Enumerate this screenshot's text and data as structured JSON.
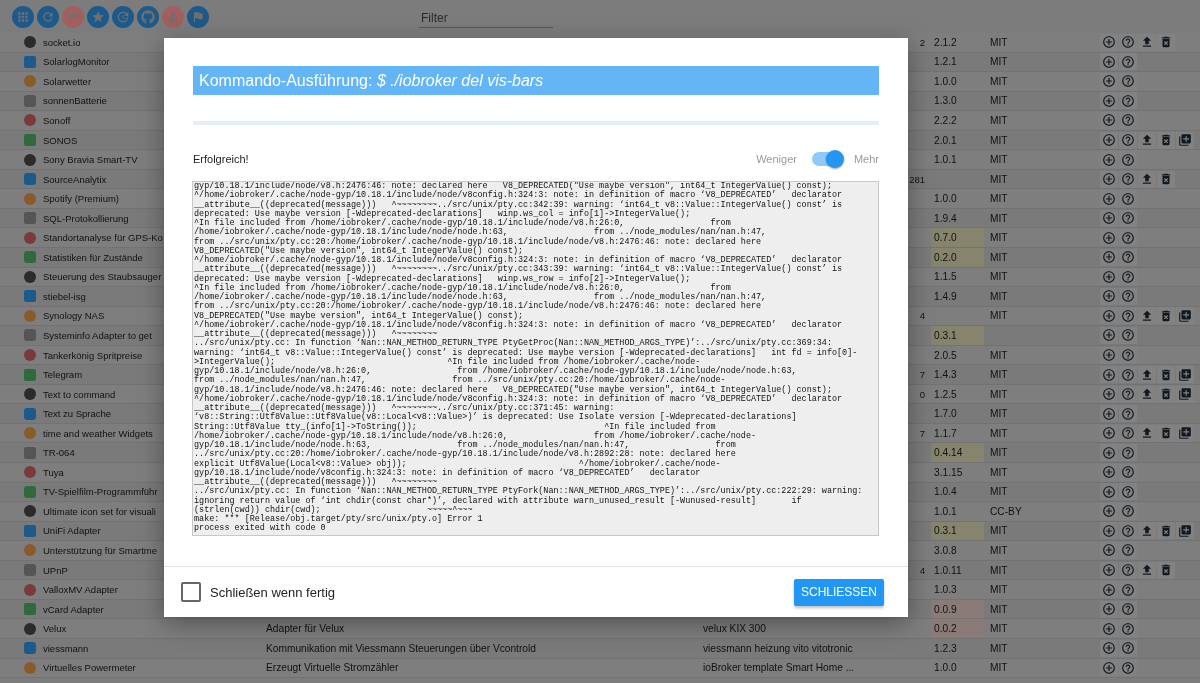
{
  "toolbar": {
    "buttons": [
      {
        "kind": "apps",
        "color": "#1d5a8c"
      },
      {
        "kind": "refresh",
        "color": "#1d5a8c"
      },
      {
        "kind": "list",
        "color": "#a35f5f"
      },
      {
        "kind": "star",
        "color": "#1d5a8c"
      },
      {
        "kind": "update",
        "color": "#1d5a8c"
      },
      {
        "kind": "github",
        "color": "#1d5a8c"
      },
      {
        "kind": "person",
        "color": "#a35f5f"
      },
      {
        "kind": "flag",
        "color": "#1d5a8c"
      }
    ],
    "filter": {
      "placeholder": "Filter"
    }
  },
  "adapters": [
    {
      "name": "socket.io",
      "installed": "2",
      "version": "2.1.2",
      "license": "MIT",
      "upgrade": true,
      "delete": true,
      "add_instance": false
    },
    {
      "name": "SolarlogMonitor",
      "version": "1.2.1",
      "license": "MIT",
      "upgrade": false,
      "delete": false,
      "add_instance": false
    },
    {
      "name": "Solarwetter",
      "version": "1.0.0",
      "license": "MIT",
      "upgrade": false,
      "delete": false,
      "add_instance": false
    },
    {
      "name": "sonnenBatterie",
      "version": "1.3.0",
      "license": "MIT",
      "upgrade": false,
      "delete": false,
      "add_instance": false
    },
    {
      "name": "Sonoff",
      "version": "2.2.2",
      "license": "MIT",
      "upgrade": false,
      "delete": false,
      "add_instance": false
    },
    {
      "name": "SONOS",
      "version": "2.0.1",
      "license": "MIT",
      "upgrade": true,
      "delete": true,
      "add_instance": true
    },
    {
      "name": "Sony Bravia Smart-TV",
      "version": "1.0.1",
      "license": "MIT",
      "upgrade": false,
      "delete": false,
      "add_instance": false
    },
    {
      "name": "SourceAnalytix",
      "installed": "281",
      "license": "MIT",
      "upgrade": true,
      "delete": true,
      "add_instance": false
    },
    {
      "name": "Spotify (Premium)",
      "version": "1.0.0",
      "license": "MIT",
      "upgrade": false,
      "delete": false,
      "add_instance": false
    },
    {
      "name": "SQL-Protokollierung",
      "version": "1.9.4",
      "license": "MIT",
      "upgrade": false,
      "delete": false,
      "add_instance": false
    },
    {
      "name": "Standortanalyse für GPS-Ko",
      "version": "0.7.0",
      "color": "#86846c",
      "license": "MIT",
      "upgrade": false,
      "delete": false,
      "add_instance": false
    },
    {
      "name": "Statistiken für Zustände",
      "version": "0.2.0",
      "color": "#86846c",
      "license": "MIT",
      "upgrade": false,
      "delete": false,
      "add_instance": false
    },
    {
      "name": "Steuerung des Staubsauger",
      "version": "1.1.5",
      "license": "MIT",
      "upgrade": false,
      "delete": false,
      "add_instance": false
    },
    {
      "name": "stiebel-isg",
      "version": "1.4.9",
      "license": "MIT",
      "upgrade": false,
      "delete": false,
      "add_instance": false
    },
    {
      "name": "Synology NAS",
      "installed": "4",
      "license": "MIT",
      "upgrade": true,
      "delete": true,
      "add_instance": true
    },
    {
      "name": "Systeminfo Adapter to get",
      "version": "0.3.1",
      "color": "#86846c",
      "upgrade": false,
      "delete": false,
      "add_instance": false
    },
    {
      "name": "Tankerkönig Spritpreise",
      "version": "2.0.5",
      "license": "MIT",
      "upgrade": false,
      "delete": false,
      "add_instance": false
    },
    {
      "name": "Telegram",
      "installed": "7",
      "version": "1.4.3",
      "license": "MIT",
      "upgrade": true,
      "delete": true,
      "add_instance": true
    },
    {
      "name": "Text to command",
      "installed": "0",
      "version": "1.2.5",
      "license": "MIT",
      "upgrade": true,
      "delete": true,
      "add_instance": true
    },
    {
      "name": "Text zu Sprache",
      "version": "1.7.0",
      "license": "MIT",
      "upgrade": false,
      "delete": false,
      "add_instance": false
    },
    {
      "name": "time and weather Widgets",
      "installed": "7",
      "version": "1.1.7",
      "license": "MIT",
      "upgrade": true,
      "delete": true,
      "add_instance": true
    },
    {
      "name": "TR-064",
      "version": "0.4.14",
      "color": "#86846c",
      "license": "MIT",
      "upgrade": false,
      "delete": false,
      "add_instance": false
    },
    {
      "name": "Tuya",
      "version": "3.1.15",
      "license": "MIT",
      "upgrade": false,
      "delete": false,
      "add_instance": false
    },
    {
      "name": "TV-Spielfilm-Programmführ",
      "version": "1.0.4",
      "license": "MIT",
      "upgrade": false,
      "delete": false,
      "add_instance": false
    },
    {
      "name": "Ultimate icon set for visuali",
      "version": "1.0.1",
      "license": "CC-BY",
      "upgrade": false,
      "delete": false,
      "add_instance": false
    },
    {
      "name": "UniFi Adapter",
      "version": "0.3.1",
      "color": "#86846c",
      "license": "MIT",
      "upgrade": true,
      "delete": true,
      "add_instance": true
    },
    {
      "name": "Unterstützung für Smartme",
      "version": "3.0.8",
      "license": "MIT",
      "upgrade": false,
      "delete": false,
      "add_instance": false
    },
    {
      "name": "UPnP",
      "installed": "4",
      "version": "1.0.11",
      "license": "MIT",
      "upgrade": true,
      "delete": true,
      "add_instance": false
    },
    {
      "name": "ValloxMV Adapter",
      "version": "1.0.3",
      "license": "MIT",
      "upgrade": false,
      "delete": false,
      "add_instance": false
    },
    {
      "name": "vCard Adapter",
      "version": "0.0.9",
      "color": "#8a7a78",
      "license": "MIT",
      "upgrade": false,
      "delete": false,
      "add_instance": false
    },
    {
      "name": "Velux",
      "description": "Adapter für Velux",
      "keywords": "velux KIX 300",
      "version": "0.0.2",
      "color": "#8a7a78",
      "license": "MIT",
      "upgrade": false,
      "delete": false,
      "add_instance": false
    },
    {
      "name": "viessmann",
      "description": "Kommunikation mit Viessmann Steuerungen über Vcontrold",
      "keywords": "viessmann heizung vito vitotronic",
      "version": "1.2.3",
      "license": "MIT",
      "upgrade": false,
      "delete": false,
      "add_instance": false
    },
    {
      "name": "Virtuelles Powermeter",
      "description": "Erzeugt Virtuelle Stromzähler",
      "keywords": "ioBroker template Smart Home ...",
      "version": "1.0.0",
      "license": "MIT",
      "upgrade": false,
      "delete": false,
      "add_instance": false
    }
  ],
  "dialog": {
    "title": "Kommando-Ausführung: *$ ./iobroker del vis-bars*",
    "progress": {
      "level": 1
    },
    "status": "Erfolgreich!",
    "verbosity": {
      "less_label": "Weniger",
      "more_label": "Mehr",
      "on": true
    },
    "log_lines": [
      "gyp/10.18.1/include/node/v8.h:2476:46: note: declared here   V8_DEPRECATED(\"Use maybe version\", int64_t IntegerValue() const);",
      "^/home/iobroker/.cache/node-gyp/10.18.1/include/node/v8config.h:324:3: note: in definition of macro ‘V8_DEPRECATED’   declarator",
      "__attribute__((deprecated(message)))   ^~~~~~~~~../src/unix/pty.cc:342:39: warning: ‘int64_t v8::Value::IntegerValue() const’ is",
      "deprecated: Use maybe version [-Wdeprecated-declarations]   winp.ws_col = info[1]->IntegerValue();",
      "^In file included from /home/iobroker/.cache/node-gyp/10.18.1/include/node/v8.h:26:0,                 from",
      "/home/iobroker/.cache/node-gyp/10.18.1/include/node/node.h:63,                 from ../node_modules/nan/nan.h:47,",
      "from ../src/unix/pty.cc:20:/home/iobroker/.cache/node-gyp/10.18.1/include/node/v8.h:2476:46: note: declared here",
      "V8_DEPRECATED(\"Use maybe version\", int64_t IntegerValue() const);",
      "^/home/iobroker/.cache/node-gyp/10.18.1/include/node/v8config.h:324:3: note: in definition of macro ‘V8_DEPRECATED’   declarator",
      "__attribute__((deprecated(message)))   ^~~~~~~~~../src/unix/pty.cc:343:39: warning: ‘int64_t v8::Value::IntegerValue() const’ is",
      "deprecated: Use maybe version [-Wdeprecated-declarations]   winp.ws_row = info[2]->IntegerValue();",
      "^In file included from /home/iobroker/.cache/node-gyp/10.18.1/include/node/v8.h:26:0,                 from",
      "/home/iobroker/.cache/node-gyp/10.18.1/include/node/node.h:63,                 from ../node_modules/nan/nan.h:47,",
      "from ../src/unix/pty.cc:20:/home/iobroker/.cache/node-gyp/10.18.1/include/node/v8.h:2476:46: note: declared here",
      "V8_DEPRECATED(\"Use maybe version\", int64_t IntegerValue() const);",
      "^/home/iobroker/.cache/node-gyp/10.18.1/include/node/v8config.h:324:3: note: in definition of macro ‘V8_DEPRECATED’   declarator",
      "__attribute__((deprecated(message)))   ^~~~~~~~~",
      "../src/unix/pty.cc: In function ‘Nan::NAN_METHOD_RETURN_TYPE PtyGetProc(Nan::NAN_METHOD_ARGS_TYPE)’:../src/unix/pty.cc:369:34:",
      "warning: ‘int64_t v8::Value::IntegerValue() const’ is deprecated: Use maybe version [-Wdeprecated-declarations]   int fd = info[0]-",
      ">IntegerValue();                                  ^In file included from /home/iobroker/.cache/node-",
      "gyp/10.18.1/include/node/v8.h:26:0,                 from /home/iobroker/.cache/node-gyp/10.18.1/include/node/node.h:63,",
      "from ../node_modules/nan/nan.h:47,                 from ../src/unix/pty.cc:20:/home/iobroker/.cache/node-",
      "gyp/10.18.1/include/node/v8.h:2476:46: note: declared here   V8_DEPRECATED(\"Use maybe version\", int64_t IntegerValue() const);",
      "^/home/iobroker/.cache/node-gyp/10.18.1/include/node/v8config.h:324:3: note: in definition of macro ‘V8_DEPRECATED’   declarator",
      "__attribute__((deprecated(message)))   ^~~~~~~~~../src/unix/pty.cc:371:45: warning:",
      "‘v8::String::Utf8Value::Utf8Value(v8::Local<v8::Value>)’ is deprecated: Use Isolate version [-Wdeprecated-declarations]",
      "String::Utf8Value tty_(info[1]->ToString());                                     ^In file included from",
      "/home/iobroker/.cache/node-gyp/10.18.1/include/node/v8.h:26:0,                 from /home/iobroker/.cache/node-",
      "gyp/10.18.1/include/node/node.h:63,                 from ../node_modules/nan/nan.h:47,                 from",
      "../src/unix/pty.cc:20:/home/iobroker/.cache/node-gyp/10.18.1/include/node/v8.h:2892:28: note: declared here",
      "explicit Utf8Value(Local<v8::Value> obj));                                  ^/home/iobroker/.cache/node-",
      "gyp/10.18.1/include/node/v8config.h:324:3: note: in definition of macro ‘V8_DEPRECATED’   declarator",
      "__attribute__((deprecated(message)))   ^~~~~~~~~",
      "../src/unix/pty.cc: In function ‘Nan::NAN_METHOD_RETURN_TYPE PtyFork(Nan::NAN_METHOD_ARGS_TYPE)’:../src/unix/pty.cc:222:29: warning:",
      "ignoring return value of ‘int chdir(const char*)’, declared with attribute warn_unused_result [-Wunused-result]       if",
      "(strlen(cwd)) chdir(cwd);                     ~~~~~^~~~",
      "make: *** [Release/obj.target/pty/src/unix/pty.o] Error 1",
      "process exited with code 0"
    ],
    "close_when_done": {
      "label": "Schließen wenn fertig",
      "checked": false
    },
    "close_button": "SCHLIESSEN"
  }
}
